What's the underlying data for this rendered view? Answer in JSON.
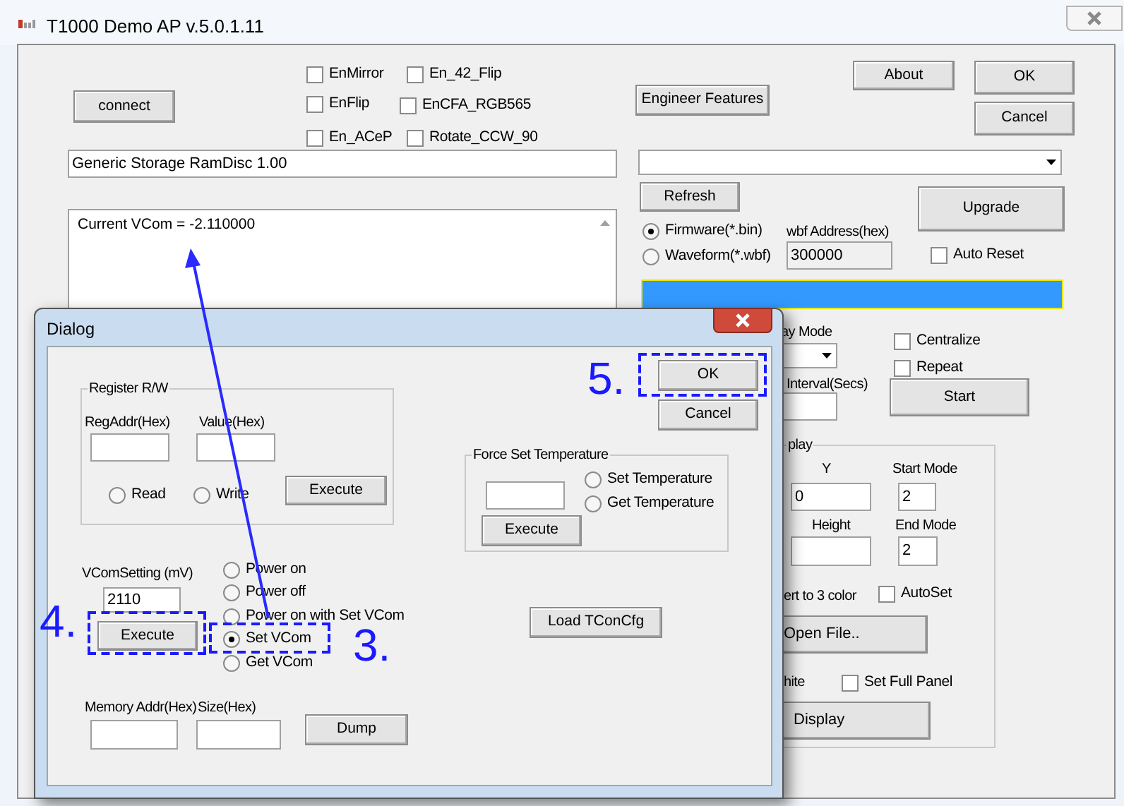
{
  "main_window": {
    "title": "T1000 Demo AP v.5.0.1.11",
    "connect_button": "connect",
    "options": [
      {
        "label": "EnMirror",
        "checked": false
      },
      {
        "label": "En_42_Flip",
        "checked": false
      },
      {
        "label": "EnFlip",
        "checked": false
      },
      {
        "label": "EnCFA_RGB565",
        "checked": false
      },
      {
        "label": "En_ACeP",
        "checked": false
      },
      {
        "label": "Rotate_CCW_90",
        "checked": false
      }
    ],
    "engineer_button": "Engineer Features",
    "about_button": "About",
    "ok_button": "OK",
    "cancel_button": "Cancel",
    "device_field": "Generic Storage RamDisc 1.00",
    "log": "Current VCom = -2.110000",
    "refresh_button": "Refresh",
    "upgrade_button": "Upgrade",
    "file_types": [
      {
        "label": "Firmware(*.bin)",
        "selected": true
      },
      {
        "label": "Waveform(*.wbf)",
        "selected": false
      }
    ],
    "wbf_address": {
      "label": "wbf Address(hex)",
      "value": "300000"
    },
    "auto_reset": {
      "label": "Auto Reset",
      "checked": false
    },
    "progress": {
      "level": 1
    },
    "display_mode_label": "ay Mode",
    "interval_label": "Interval(Secs)",
    "playback_options": [
      {
        "label": "Centralize",
        "checked": false
      },
      {
        "label": "Repeat",
        "checked": false
      }
    ],
    "start_button": "Start",
    "display_group": {
      "legend": "play",
      "y": {
        "label": "Y",
        "value": "0"
      },
      "start_mode": {
        "label": "Start Mode",
        "value": "2"
      },
      "height": {
        "label": "Height"
      },
      "end_mode": {
        "label": "End Mode",
        "value": "2"
      },
      "convert_label": "ert to 3 color",
      "autoset": {
        "label": "AutoSet",
        "checked": false
      },
      "open_file_button": "Open File..",
      "white_label": "hite",
      "set_full_panel": {
        "label": "Set Full Panel",
        "checked": false
      },
      "display_button": "Display"
    }
  },
  "dialog": {
    "title": "Dialog",
    "register_group": {
      "legend": "Register R/W",
      "reg_addr_label": "RegAddr(Hex)",
      "value_label": "Value(Hex)",
      "modes": [
        {
          "label": "Read",
          "selected": false
        },
        {
          "label": "Write",
          "selected": false
        }
      ],
      "execute_button": "Execute"
    },
    "vcom": {
      "label": "VComSetting (mV)",
      "value": "2110",
      "execute_button": "Execute",
      "actions": [
        {
          "label": "Power on",
          "selected": false
        },
        {
          "label": "Power off",
          "selected": false
        },
        {
          "label": "Power on with Set VCom",
          "selected": false
        },
        {
          "label": "Set VCom",
          "selected": true
        },
        {
          "label": "Get VCom",
          "selected": false
        }
      ]
    },
    "memory": {
      "addr_label": "Memory Addr(Hex)",
      "size_label": "Size(Hex)",
      "dump_button": "Dump"
    },
    "temperature_group": {
      "legend": "Force Set Temperature",
      "modes": [
        {
          "label": "Set Temperature",
          "selected": false
        },
        {
          "label": "Get Temperature",
          "selected": false
        }
      ],
      "execute_button": "Execute"
    },
    "load_button": "Load TConCfg",
    "ok_button": "OK",
    "cancel_button": "Cancel"
  },
  "annotations": [
    {
      "label": "5."
    },
    {
      "label": "4."
    },
    {
      "label": "3."
    }
  ]
}
